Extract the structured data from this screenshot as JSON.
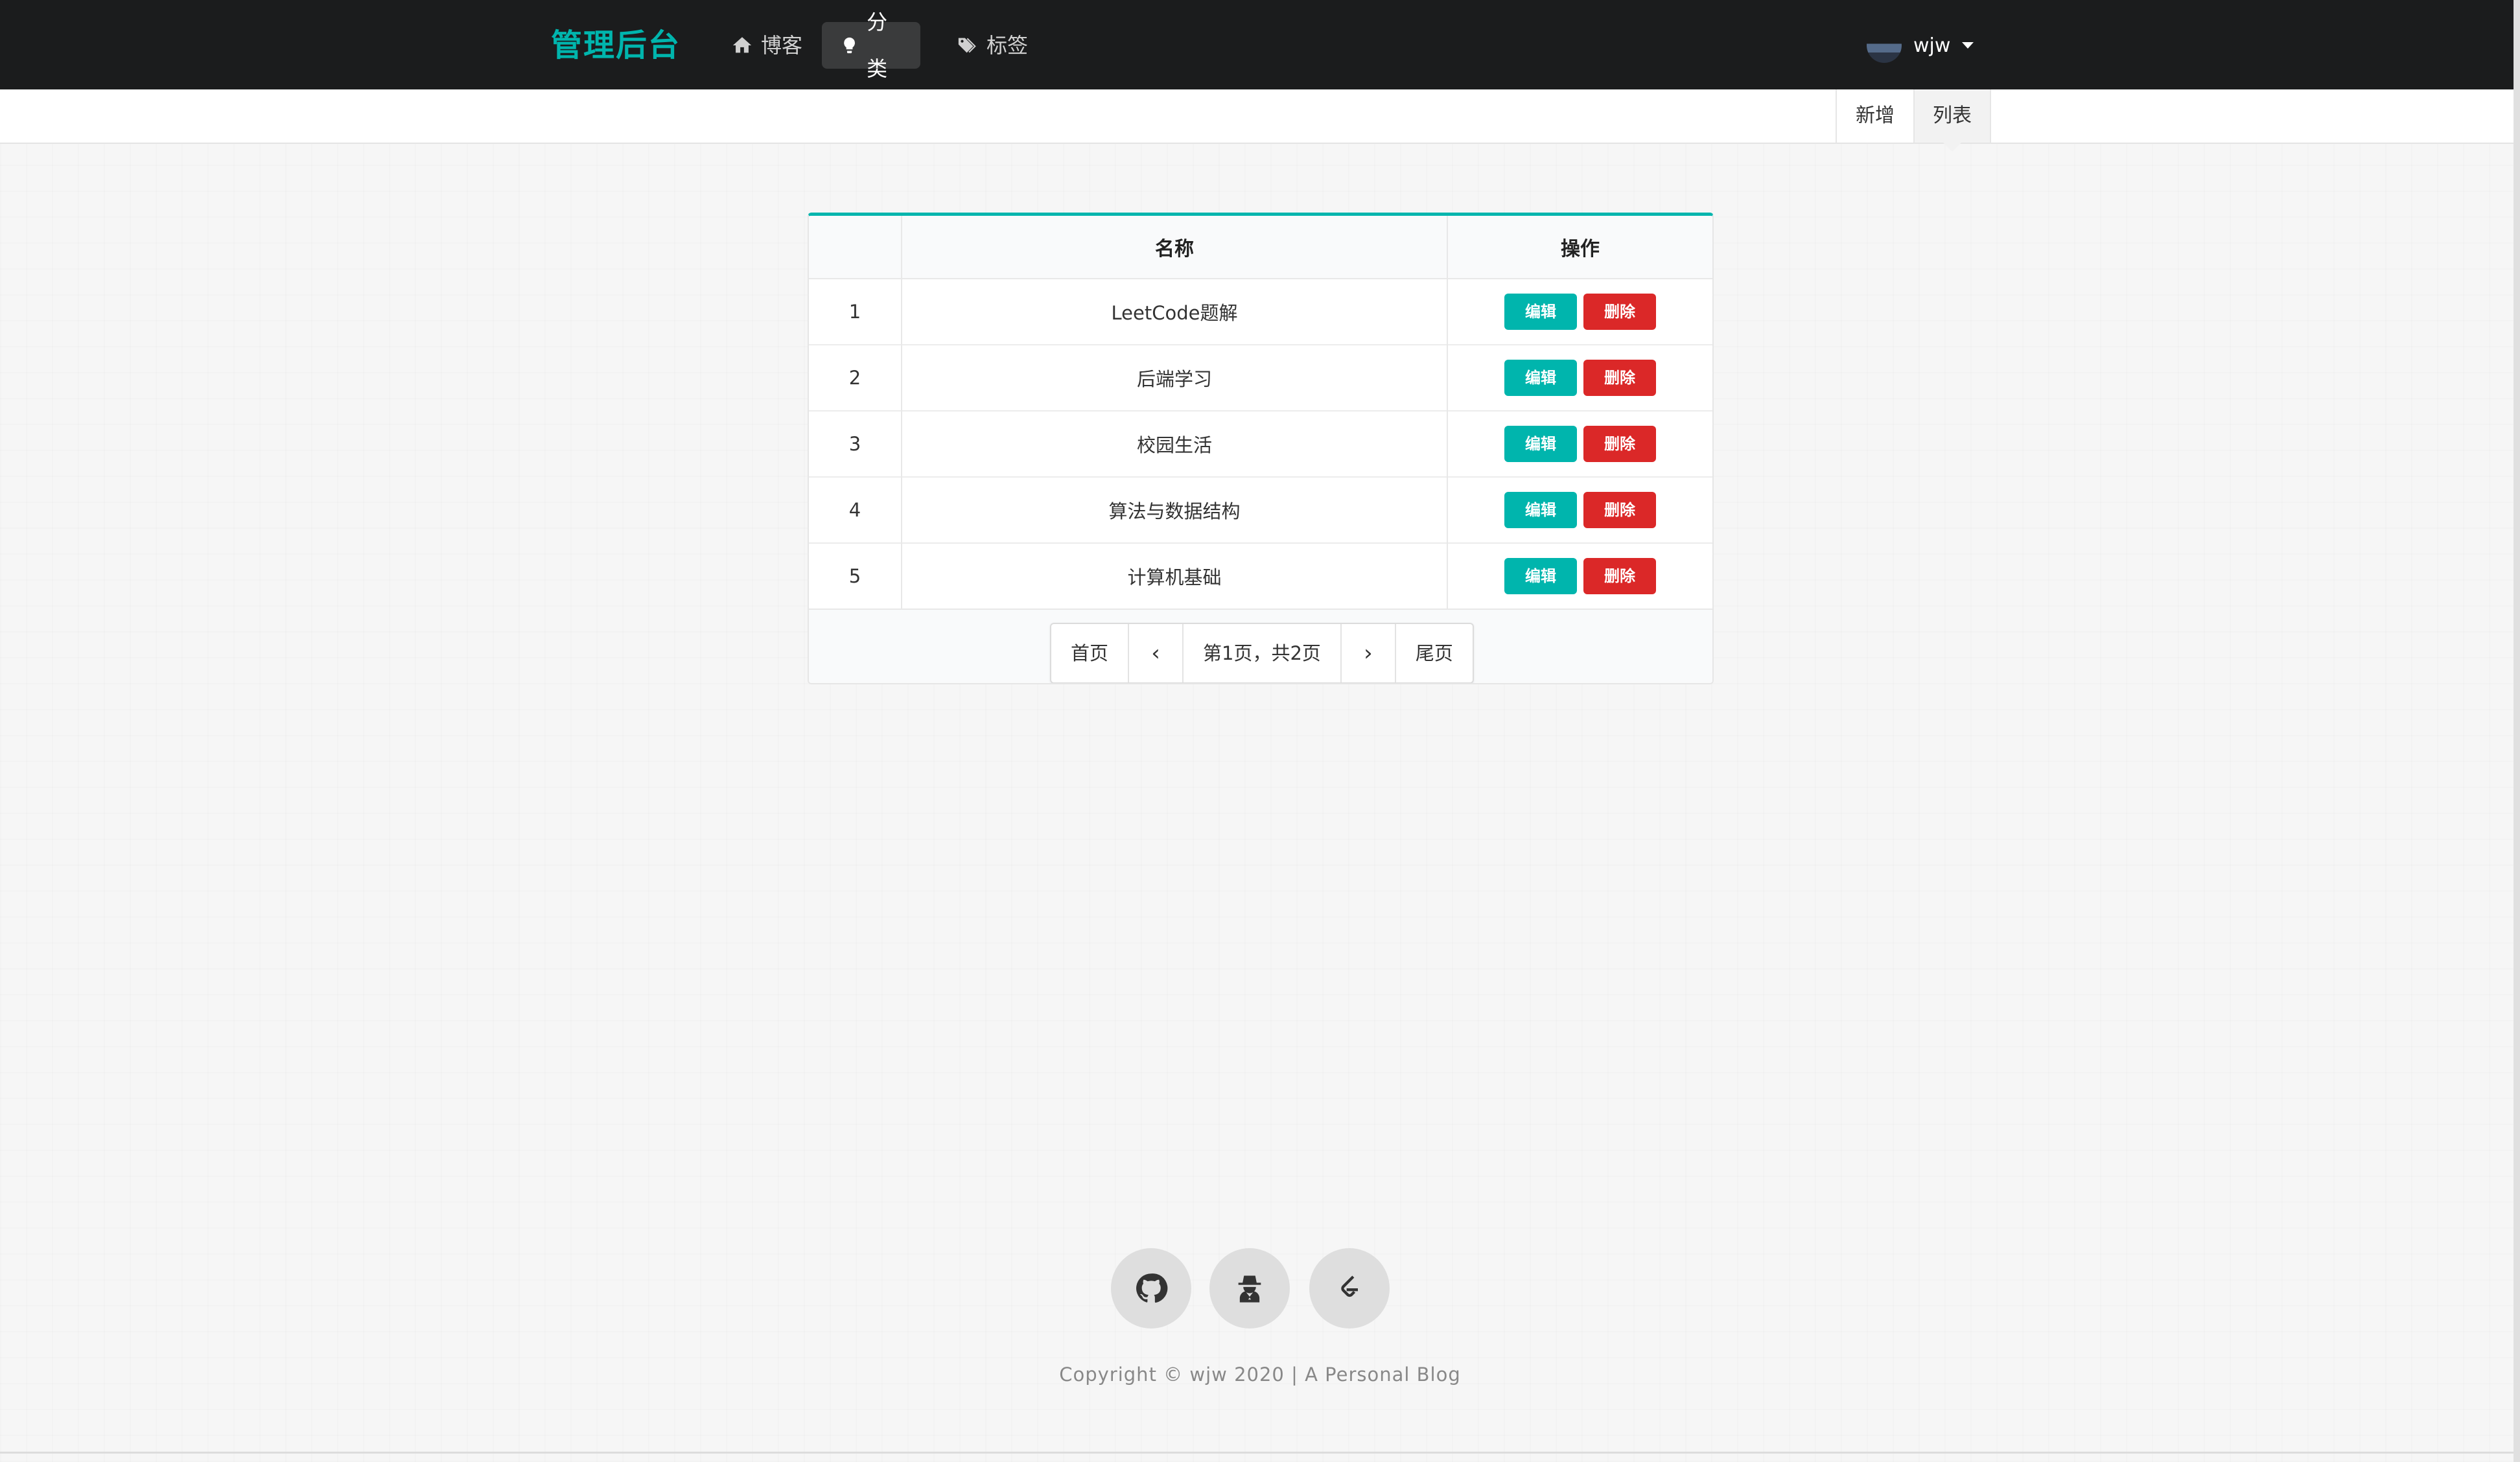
{
  "navbar": {
    "brand": "管理后台",
    "items": [
      {
        "label": "博客",
        "icon": "home-icon"
      },
      {
        "label": "分类",
        "icon": "lightbulb-icon",
        "active": true
      },
      {
        "label": "标签",
        "icon": "tags-icon"
      }
    ],
    "user": {
      "name": "wjw"
    }
  },
  "submenu": {
    "new_label": "新增",
    "list_label": "列表",
    "active": "列表"
  },
  "table": {
    "headers": [
      "",
      "名称",
      "操作"
    ],
    "rows": [
      {
        "index": "1",
        "name": "LeetCode题解"
      },
      {
        "index": "2",
        "name": "后端学习"
      },
      {
        "index": "3",
        "name": "校园生活"
      },
      {
        "index": "4",
        "name": "算法与数据结构"
      },
      {
        "index": "5",
        "name": "计算机基础"
      }
    ],
    "edit_label": "编辑",
    "delete_label": "删除",
    "pagination": {
      "first": "首页",
      "prev": "‹",
      "status": "第1页，共2页",
      "next": "›",
      "last": "尾页"
    }
  },
  "footer": {
    "socials": [
      "github-icon",
      "user-secret-icon",
      "leetcode-icon"
    ],
    "copyright": "Copyright © wjw 2020 | A Personal Blog"
  },
  "colors": {
    "accent": "#00b5ad",
    "danger": "#db2828",
    "navbar": "#1b1c1d"
  }
}
